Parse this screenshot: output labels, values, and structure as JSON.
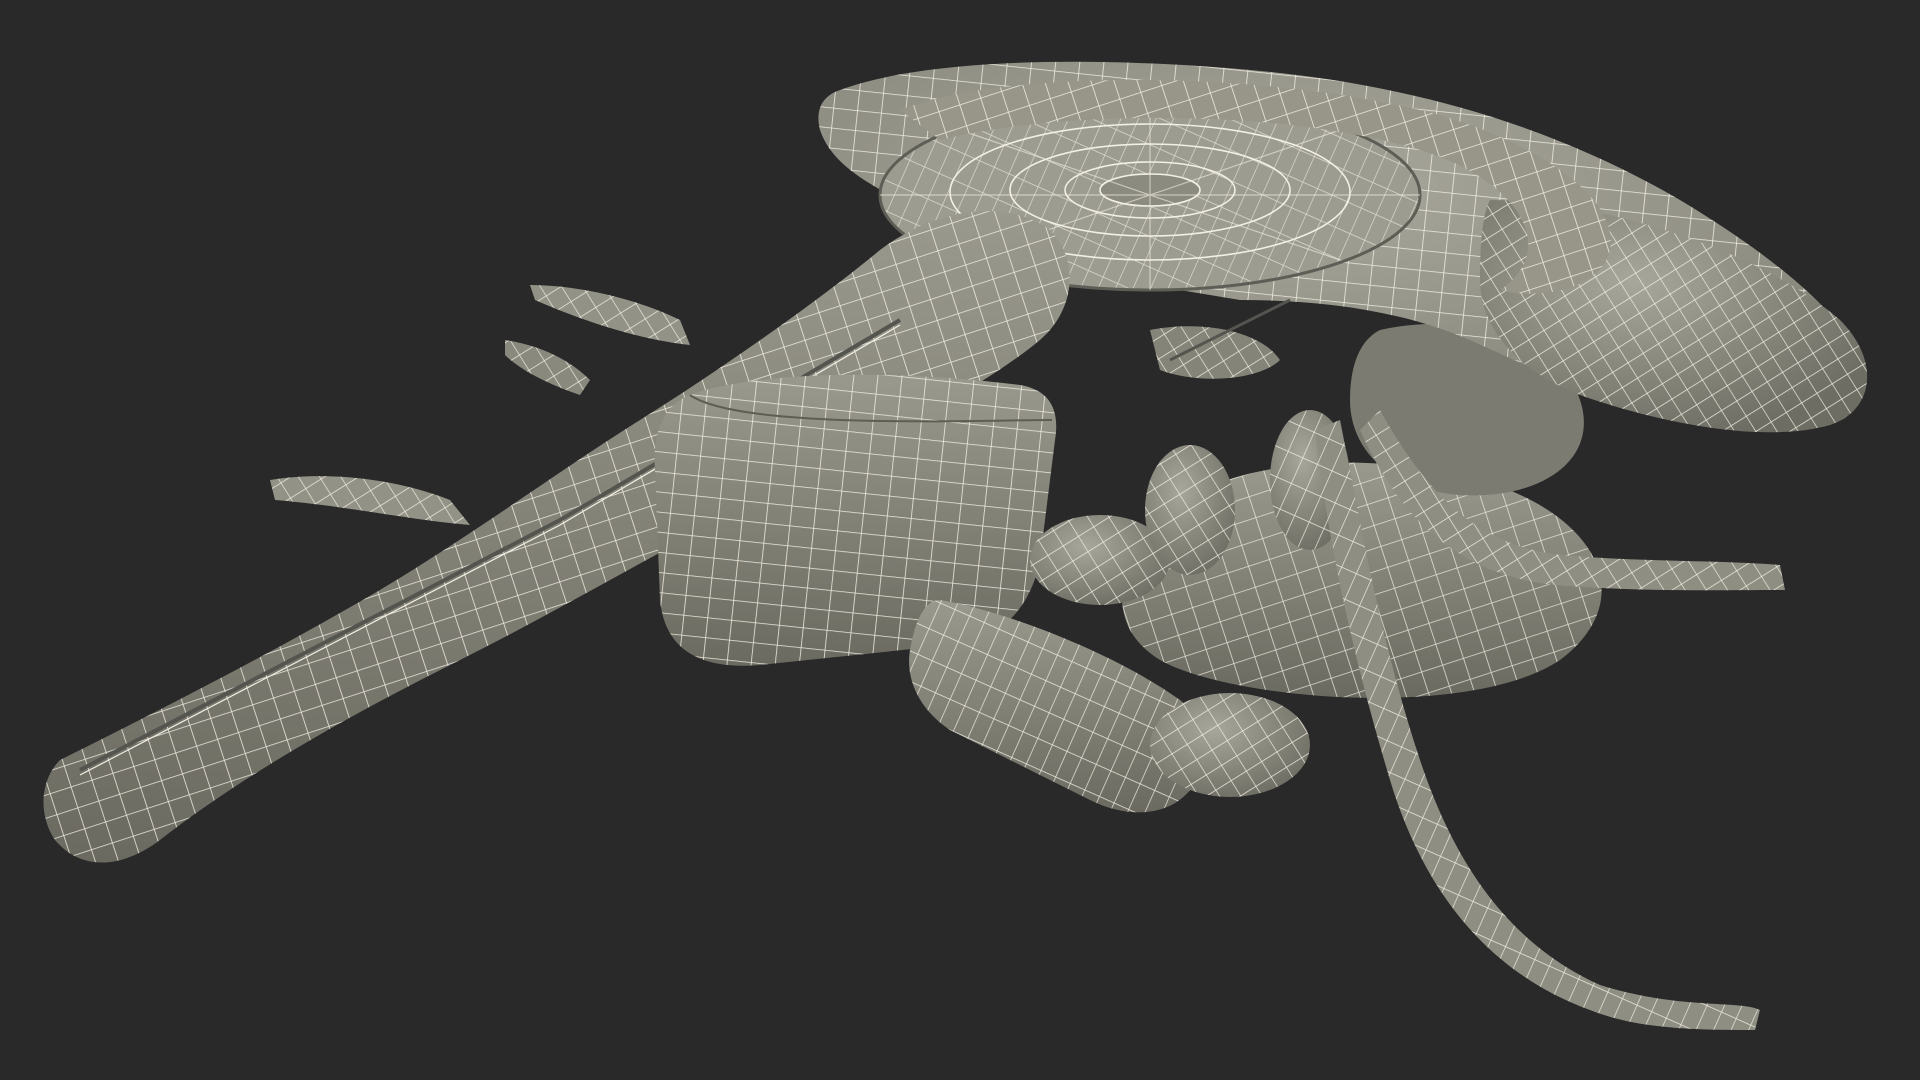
{
  "scene": {
    "subject": "wireframe-3d-model",
    "colors": {
      "background": "#29292a",
      "surface_light": "#a3a296",
      "surface_mid": "#8e8d81",
      "surface_dark": "#6b6a60",
      "shadow": "#4a4a44",
      "wire": "#f2efe4"
    }
  }
}
